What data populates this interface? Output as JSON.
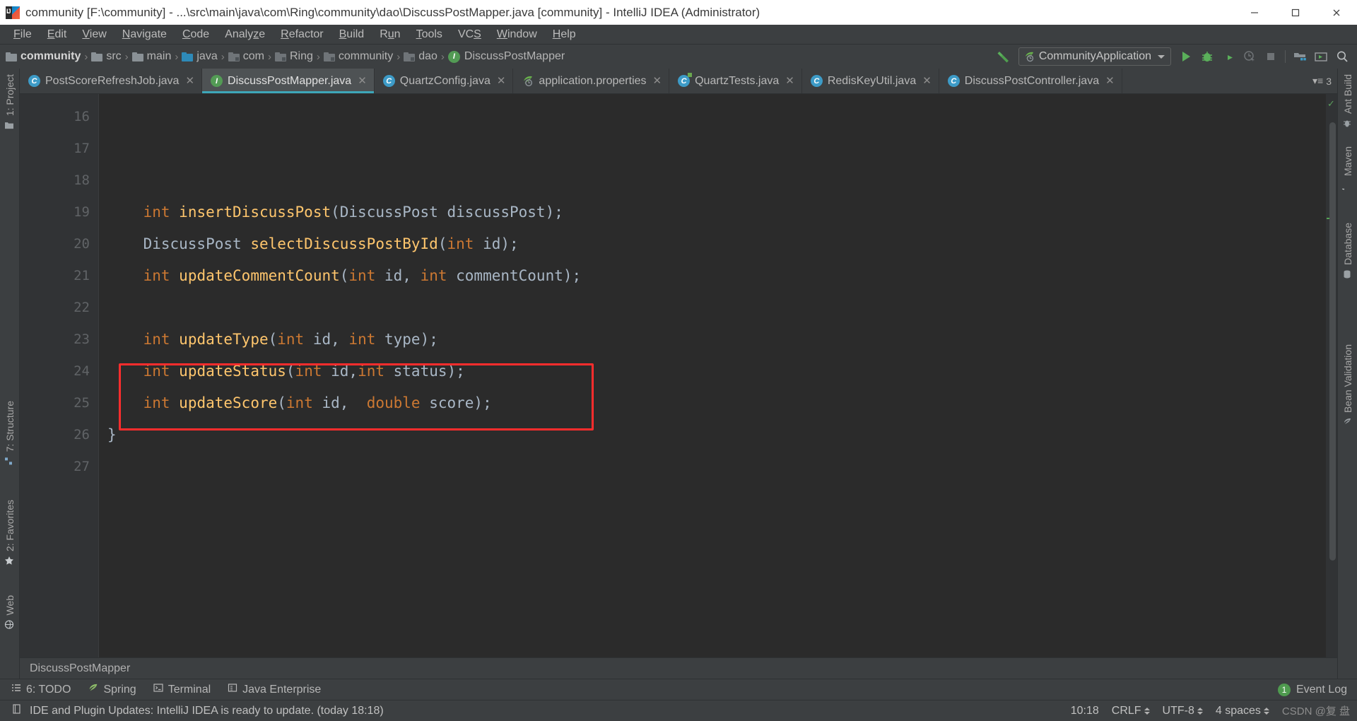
{
  "window": {
    "title": "community [F:\\community] - ...\\src\\main\\java\\com\\Ring\\community\\dao\\DiscussPostMapper.java [community] - IntelliJ IDEA (Administrator)",
    "app_icon": "intellij-idea-icon",
    "controls": {
      "minimize": "minimize-icon",
      "maximize": "maximize-icon",
      "close": "close-icon"
    }
  },
  "menubar": {
    "items": [
      {
        "label": "File",
        "mnemonic": "F"
      },
      {
        "label": "Edit",
        "mnemonic": "E"
      },
      {
        "label": "View",
        "mnemonic": "V"
      },
      {
        "label": "Navigate",
        "mnemonic": "N"
      },
      {
        "label": "Code",
        "mnemonic": "C"
      },
      {
        "label": "Analyze",
        "mnemonic": "z"
      },
      {
        "label": "Refactor",
        "mnemonic": "R"
      },
      {
        "label": "Build",
        "mnemonic": "B"
      },
      {
        "label": "Run",
        "mnemonic": "u"
      },
      {
        "label": "Tools",
        "mnemonic": "T"
      },
      {
        "label": "VCS",
        "mnemonic": "S"
      },
      {
        "label": "Window",
        "mnemonic": "W"
      },
      {
        "label": "Help",
        "mnemonic": "H"
      }
    ]
  },
  "navbar": {
    "breadcrumbs": [
      {
        "label": "community",
        "icon": "folder-icon",
        "bold": true
      },
      {
        "label": "src",
        "icon": "folder-icon",
        "bold": false
      },
      {
        "label": "main",
        "icon": "folder-icon",
        "bold": false
      },
      {
        "label": "java",
        "icon": "folder-source-icon",
        "bold": false
      },
      {
        "label": "com",
        "icon": "folder-package-icon",
        "bold": false
      },
      {
        "label": "Ring",
        "icon": "folder-package-icon",
        "bold": false
      },
      {
        "label": "community",
        "icon": "folder-package-icon",
        "bold": false
      },
      {
        "label": "dao",
        "icon": "folder-package-icon",
        "bold": false
      },
      {
        "label": "DiscussPostMapper",
        "icon": "java-interface-icon",
        "bold": false
      }
    ],
    "separator": "›",
    "build_icon": "hammer-build-icon",
    "run_config": {
      "label": "CommunityApplication",
      "icon": "spring-boot-icon",
      "dropdown": "chevron-down-icon"
    },
    "buttons": [
      {
        "name": "run-button",
        "icon": "run-play-icon"
      },
      {
        "name": "debug-button",
        "icon": "debug-bug-icon"
      },
      {
        "name": "run-with-coverage-button",
        "icon": "coverage-icon"
      },
      {
        "name": "profile-button",
        "icon": "profiler-icon"
      },
      {
        "name": "stop-button",
        "icon": "stop-square-icon"
      },
      {
        "name": "project-structure-button",
        "icon": "project-structure-icon"
      },
      {
        "name": "terminal-button",
        "icon": "terminal-window-icon"
      },
      {
        "name": "search-everywhere-button",
        "icon": "search-icon"
      }
    ]
  },
  "rails": {
    "left": [
      {
        "label": "1: Project",
        "icon": "project-folder-icon",
        "mnemonic": "1"
      },
      {
        "label": "7: Structure",
        "icon": "structure-icon",
        "mnemonic": "7"
      },
      {
        "label": "2: Favorites",
        "icon": "star-icon",
        "mnemonic": "2"
      },
      {
        "label": "Web",
        "icon": "web-globe-icon",
        "mnemonic": ""
      }
    ],
    "right": [
      {
        "label": "Ant Build",
        "icon": "ant-icon"
      },
      {
        "label": "Maven",
        "icon": "maven-m-icon"
      },
      {
        "label": "Database",
        "icon": "database-icon"
      },
      {
        "label": "Bean Validation",
        "icon": "bean-validation-icon"
      }
    ]
  },
  "tabs": [
    {
      "label": "PostScoreRefreshJob.java",
      "icon": "java-class-icon",
      "active": false,
      "close": "close-icon"
    },
    {
      "label": "DiscussPostMapper.java",
      "icon": "java-interface-icon",
      "active": true,
      "close": "close-icon"
    },
    {
      "label": "QuartzConfig.java",
      "icon": "java-class-icon",
      "active": false,
      "close": "close-icon"
    },
    {
      "label": "application.properties",
      "icon": "spring-boot-icon",
      "active": false,
      "close": "close-icon"
    },
    {
      "label": "QuartzTests.java",
      "icon": "java-test-class-icon",
      "active": false,
      "close": "close-icon"
    },
    {
      "label": "RedisKeyUtil.java",
      "icon": "java-class-icon",
      "active": false,
      "close": "close-icon"
    },
    {
      "label": "DiscussPostController.java",
      "icon": "java-class-icon",
      "active": false,
      "close": "close-icon"
    }
  ],
  "tabbar_overflow": {
    "count": "3",
    "icon": "tab-list-icon"
  },
  "editor": {
    "first_line_number": 16,
    "line_numbers": [
      "16",
      "17",
      "18",
      "19",
      "20",
      "21",
      "22",
      "23",
      "24",
      "25",
      "26",
      "27"
    ],
    "lines": [
      {
        "n": "16",
        "tokens": []
      },
      {
        "n": "17",
        "tokens": []
      },
      {
        "n": "18",
        "tokens": []
      },
      {
        "n": "19",
        "tokens": [
          {
            "t": "    ",
            "c": "punct"
          },
          {
            "t": "int",
            "c": "kw"
          },
          {
            "t": " ",
            "c": "punct"
          },
          {
            "t": "insertDiscussPost",
            "c": "mth"
          },
          {
            "t": "(",
            "c": "punct"
          },
          {
            "t": "DiscussPost",
            "c": "typ"
          },
          {
            "t": " discussPost",
            "c": "typ"
          },
          {
            "t": ");",
            "c": "punct"
          }
        ]
      },
      {
        "n": "20",
        "tokens": [
          {
            "t": "    ",
            "c": "punct"
          },
          {
            "t": "DiscussPost",
            "c": "typ"
          },
          {
            "t": " ",
            "c": "punct"
          },
          {
            "t": "selectDiscussPostById",
            "c": "mth"
          },
          {
            "t": "(",
            "c": "punct"
          },
          {
            "t": "int",
            "c": "kw"
          },
          {
            "t": " id",
            "c": "typ"
          },
          {
            "t": ");",
            "c": "punct"
          }
        ]
      },
      {
        "n": "21",
        "tokens": [
          {
            "t": "    ",
            "c": "punct"
          },
          {
            "t": "int",
            "c": "kw"
          },
          {
            "t": " ",
            "c": "punct"
          },
          {
            "t": "updateCommentCount",
            "c": "mth"
          },
          {
            "t": "(",
            "c": "punct"
          },
          {
            "t": "int",
            "c": "kw"
          },
          {
            "t": " id, ",
            "c": "typ"
          },
          {
            "t": "int",
            "c": "kw"
          },
          {
            "t": " commentCount",
            "c": "typ"
          },
          {
            "t": ");",
            "c": "punct"
          }
        ]
      },
      {
        "n": "22",
        "tokens": []
      },
      {
        "n": "23",
        "tokens": [
          {
            "t": "    ",
            "c": "punct"
          },
          {
            "t": "int",
            "c": "kw"
          },
          {
            "t": " ",
            "c": "punct"
          },
          {
            "t": "updateType",
            "c": "mth"
          },
          {
            "t": "(",
            "c": "punct"
          },
          {
            "t": "int",
            "c": "kw"
          },
          {
            "t": " id, ",
            "c": "typ"
          },
          {
            "t": "int",
            "c": "kw"
          },
          {
            "t": " type",
            "c": "typ"
          },
          {
            "t": ");",
            "c": "punct"
          }
        ]
      },
      {
        "n": "24",
        "tokens": [
          {
            "t": "    ",
            "c": "punct"
          },
          {
            "t": "int",
            "c": "kw"
          },
          {
            "t": " ",
            "c": "punct"
          },
          {
            "t": "updateStatus",
            "c": "mth"
          },
          {
            "t": "(",
            "c": "punct"
          },
          {
            "t": "int",
            "c": "kw"
          },
          {
            "t": " id,",
            "c": "typ"
          },
          {
            "t": "int",
            "c": "kw"
          },
          {
            "t": " status",
            "c": "typ"
          },
          {
            "t": ");",
            "c": "punct"
          }
        ]
      },
      {
        "n": "25",
        "tokens": [
          {
            "t": "    ",
            "c": "punct"
          },
          {
            "t": "int",
            "c": "kw"
          },
          {
            "t": " ",
            "c": "punct"
          },
          {
            "t": "updateScore",
            "c": "mth"
          },
          {
            "t": "(",
            "c": "punct"
          },
          {
            "t": "int",
            "c": "kw"
          },
          {
            "t": " id,  ",
            "c": "typ"
          },
          {
            "t": "double",
            "c": "kw"
          },
          {
            "t": " score",
            "c": "typ"
          },
          {
            "t": ");",
            "c": "punct"
          }
        ]
      },
      {
        "n": "26",
        "tokens": [
          {
            "t": "}",
            "c": "punct"
          }
        ]
      },
      {
        "n": "27",
        "tokens": []
      }
    ],
    "highlight_annotation": {
      "color": "#ff2d2d",
      "target_line": "25",
      "shape": "rectangle"
    },
    "breadcrumb_footer": "DiscussPostMapper",
    "inspection_status": "ok-check-icon"
  },
  "bottom_toolwindows": [
    {
      "label": "6: TODO",
      "mnemonic": "6",
      "icon": "todo-list-icon"
    },
    {
      "label": "Spring",
      "mnemonic": "",
      "icon": "spring-leaf-icon"
    },
    {
      "label": "Terminal",
      "mnemonic": "",
      "icon": "terminal-icon"
    },
    {
      "label": "Java Enterprise",
      "mnemonic": "",
      "icon": "java-enterprise-icon"
    }
  ],
  "event_log": {
    "label": "Event Log",
    "count": "1"
  },
  "statusbar": {
    "message": "IDE and Plugin Updates: IntelliJ IDEA is ready to update. (today 18:18)",
    "message_icon": "notification-icon",
    "caret_position": "10:18",
    "line_separator": "CRLF",
    "encoding": "UTF-8",
    "indent": "4 spaces",
    "watermark": "CSDN @复 盘"
  },
  "colors": {
    "accent": "#3ea6b8",
    "keyword": "#cc7832",
    "method": "#ffc66d",
    "identifier": "#a9b7c6",
    "editor_bg": "#2b2b2b",
    "chrome_bg": "#3c3f41",
    "highlight": "#ff2d2d",
    "green": "#539b55",
    "blue_icon": "#3d9bc7"
  }
}
